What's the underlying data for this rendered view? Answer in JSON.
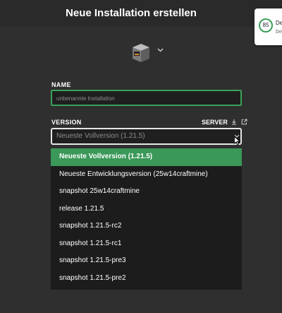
{
  "window": {
    "title": "Neue Installation erstellen"
  },
  "toast": {
    "score": "85",
    "line1": "De",
    "line2": "be"
  },
  "form": {
    "name_label": "NAME",
    "name_placeholder": "unbenannte Installation",
    "version_label": "VERSION",
    "server_label": "SERVER",
    "version_selected": "Neueste Vollversion (1.21.5)"
  },
  "dropdown": {
    "options": [
      "Neueste Vollversion (1.21.5)",
      "Neueste Entwicklungsversion (25w14craftmine)",
      "snapshot 25w14craftmine",
      "release 1.21.5",
      "snapshot 1.21.5-rc2",
      "snapshot 1.21.5-rc1",
      "snapshot 1.21.5-pre3",
      "snapshot 1.21.5-pre2"
    ]
  },
  "colors": {
    "accent": "#3a9858",
    "background": "#2f2f2f",
    "field": "#1f1f1f"
  },
  "icons": [
    "furnace-block-icon",
    "chevron-down-icon",
    "download-icon",
    "external-link-icon",
    "mouse-cursor-icon"
  ]
}
